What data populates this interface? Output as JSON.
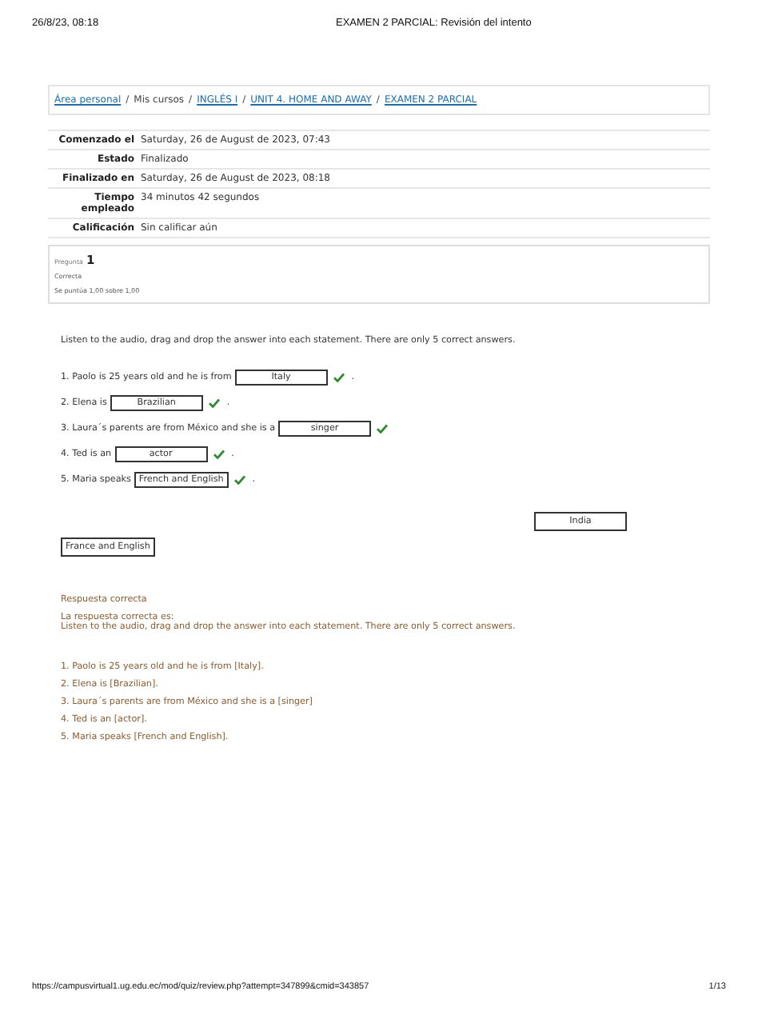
{
  "print_header": {
    "date": "26/8/23, 08:18",
    "title": "EXAMEN 2 PARCIAL: Revisión del intento"
  },
  "breadcrumb": [
    {
      "label": "Área personal",
      "link": true
    },
    {
      "label": "Mis cursos",
      "link": false
    },
    {
      "label": "INGLÉS I",
      "link": true
    },
    {
      "label": "UNIT 4. HOME AND AWAY",
      "link": true
    },
    {
      "label": "EXAMEN 2 PARCIAL",
      "link": true
    }
  ],
  "breadcrumb_separator": "/",
  "summary": [
    {
      "label": "Comenzado el",
      "value": "Saturday, 26 de August de 2023, 07:43"
    },
    {
      "label": "Estado",
      "value": "Finalizado"
    },
    {
      "label": "Finalizado en",
      "value": "Saturday, 26 de August de 2023, 08:18"
    },
    {
      "label": "Tiempo empleado",
      "value": "34 minutos 42 segundos"
    },
    {
      "label": "Calificación",
      "value": "Sin calificar aún"
    }
  ],
  "question_info": {
    "label": "Pregunta",
    "number": "1",
    "state": "Correcta",
    "mark": "Se puntúa 1,00 sobre 1,00"
  },
  "prompt": "Listen to the audio, drag and drop the answer into each statement. There are only 5 correct answers.",
  "items": [
    {
      "prefix": "1. Paolo is 25 years old and he is from",
      "answer": "Italy",
      "correct": true,
      "suffix": "."
    },
    {
      "prefix": "2. Elena is",
      "answer": "Brazilian",
      "correct": true,
      "suffix": "."
    },
    {
      "prefix": "3. Laura´s parents are from México and she is a",
      "answer": "singer",
      "correct": true
    },
    {
      "prefix": "4. Ted  is an",
      "answer": "actor",
      "correct": true,
      "suffix": "."
    },
    {
      "prefix": "5. Maria speaks",
      "answer": "French and English",
      "correct": true,
      "suffix": "."
    }
  ],
  "unused_choices": [
    {
      "label": "India",
      "kind": "right"
    },
    {
      "label": "France and English",
      "kind": "left"
    }
  ],
  "feedback": {
    "result": "Respuesta correcta",
    "intro": "La respuesta correcta es:",
    "prompt": "Listen to the audio, drag and drop the answer into each statement. There are only 5 correct answers.",
    "lines": [
      "1. Paolo is 25 years old and he is from [Italy].",
      "2. Elena is [Brazilian].",
      "3. Laura´s parents are from México and she is a [singer]",
      "4. Ted  is an [actor].",
      "5. Maria speaks [French and English]."
    ]
  },
  "print_footer": {
    "url": "https://campusvirtual1.ug.edu.ec/mod/quiz/review.php?attempt=347899&cmid=343857",
    "page": "1/13"
  }
}
